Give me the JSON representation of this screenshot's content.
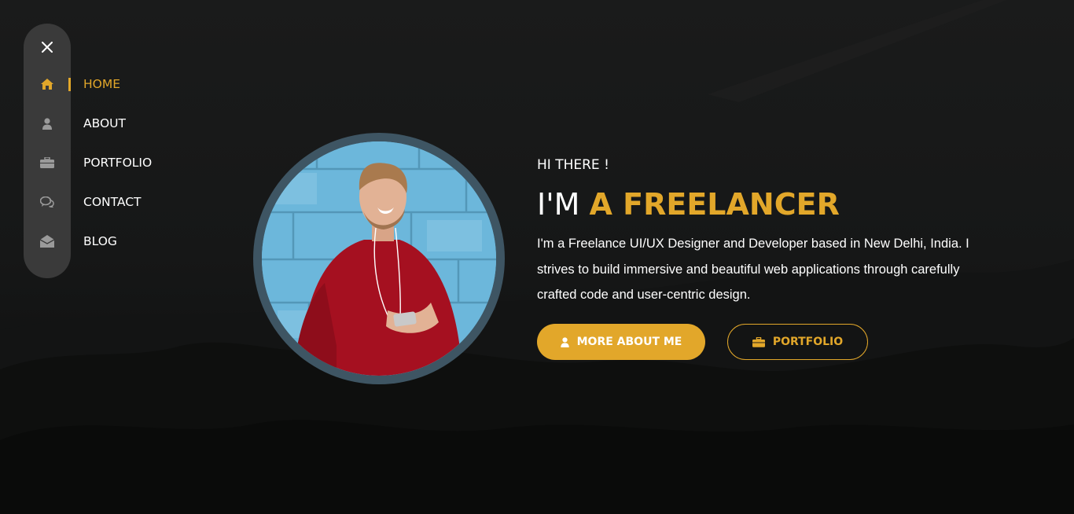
{
  "nav": {
    "close_icon": "close-icon",
    "items": [
      {
        "label": "HOME",
        "icon": "home-icon",
        "active": true
      },
      {
        "label": "ABOUT",
        "icon": "user-icon",
        "active": false
      },
      {
        "label": "PORTFOLIO",
        "icon": "briefcase-icon",
        "active": false
      },
      {
        "label": "CONTACT",
        "icon": "chat-icon",
        "active": false
      },
      {
        "label": "BLOG",
        "icon": "envelope-open-icon",
        "active": false
      }
    ]
  },
  "hero": {
    "greeting": "HI THERE !",
    "headline_prefix": "I'M ",
    "headline_role": "A FREELANCER",
    "bio": "I'm a Freelance UI/UX Designer and Developer based in New Delhi, India. I strives to build immersive and beautiful web applications through carefully crafted code and user-centric design.",
    "primary_button": {
      "label": "MORE ABOUT ME",
      "icon": "user-icon"
    },
    "secondary_button": {
      "label": "PORTFOLIO",
      "icon": "briefcase-icon"
    }
  },
  "colors": {
    "accent": "#e2a72a",
    "background": "#0f1010",
    "sidebar": "#3a3a3a",
    "text": "#ffffff"
  }
}
